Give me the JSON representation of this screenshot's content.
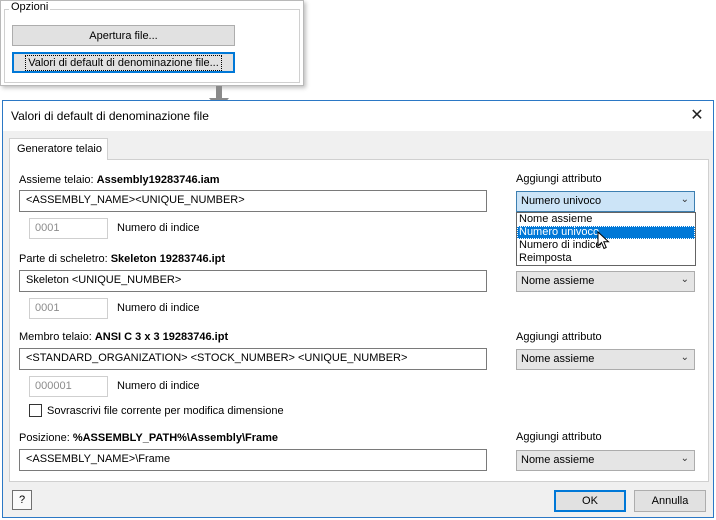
{
  "options": {
    "group_label": "Opzioni",
    "open_button": "Apertura file...",
    "defaults_button": "Valori di default di denominazione file..."
  },
  "dialog": {
    "title": "Valori di default di denominazione file",
    "close_glyph": "✕",
    "tab": "Generatore telaio",
    "add_attribute_label": "Aggiungi attributo",
    "assembly": {
      "label": "Assieme telaio:",
      "filename": "Assembly19283746.iam",
      "value": "<ASSEMBLY_NAME><UNIQUE_NUMBER>",
      "index": "0001",
      "index_label": "Numero di indice",
      "combo": "Numero univoco",
      "dropdown_options": [
        "Nome assieme",
        "Numero univoco",
        "Numero di indice",
        "Reimposta"
      ]
    },
    "skeleton": {
      "label": "Parte di scheletro:",
      "filename": "Skeleton 19283746.ipt",
      "value": "Skeleton <UNIQUE_NUMBER>",
      "index": "0001",
      "index_label": "Numero di indice",
      "combo": "Nome assieme"
    },
    "member": {
      "label": "Membro telaio:",
      "filename": "ANSI C 3 x 3 19283746.ipt",
      "value": "<STANDARD_ORGANIZATION> <STOCK_NUMBER> <UNIQUE_NUMBER>",
      "index": "000001",
      "index_label": "Numero di indice",
      "combo": "Nome assieme",
      "overwrite_label": "Sovrascrivi file corrente per modifica dimensione"
    },
    "position": {
      "label": "Posizione:",
      "filename": "%ASSEMBLY_PATH%\\Assembly\\Frame",
      "value": "<ASSEMBLY_NAME>\\Frame",
      "combo": "Nome assieme"
    },
    "help": "?",
    "ok": "OK",
    "cancel": "Annulla"
  }
}
